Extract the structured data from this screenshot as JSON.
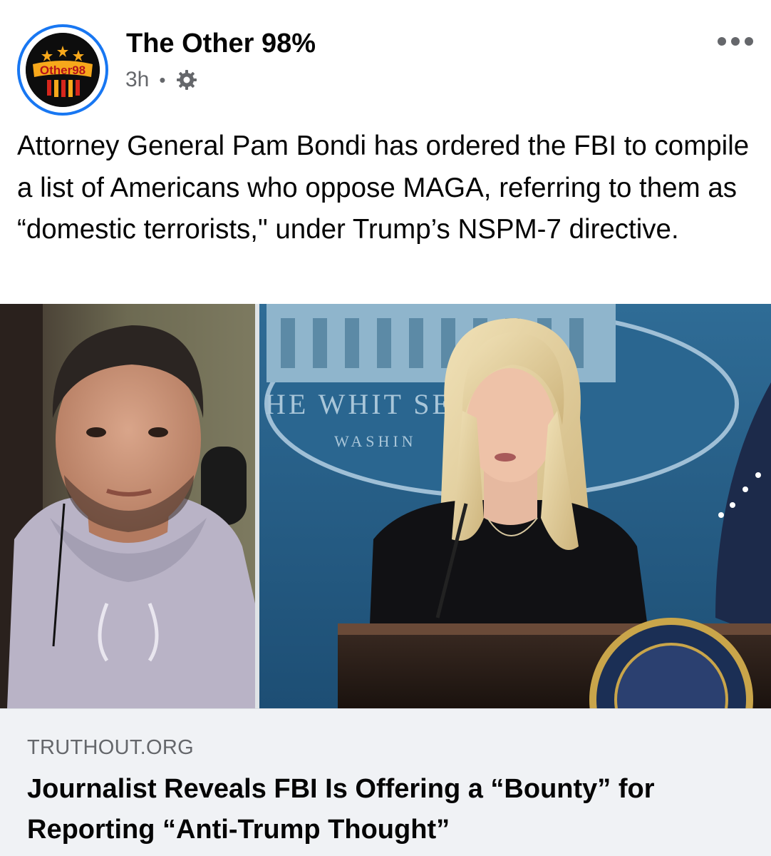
{
  "post": {
    "page_name": "The Other 98%",
    "avatar_text": "Other98",
    "time": "3h",
    "separator": "•",
    "audience_icon": "gear-icon",
    "more_icon": "more-horizontal-icon",
    "caption": "Attorney General Pam Bondi has ordered the FBI to compile a list of Americans who oppose MAGA, referring to them as “domestic terrorists,\" under Trump’s NSPM-7 directive."
  },
  "link": {
    "image_sign_top": "HE WHIT  SE",
    "image_sign_bottom": "WASHIN",
    "domain": "TRUTHOUT.ORG",
    "title": "Journalist Reveals FBI Is Offering a “Bounty” for Reporting “Anti-Trump Thought”"
  },
  "colors": {
    "brand_blue": "#1877f2",
    "secondary_text": "#65676b",
    "footer_bg": "#f0f2f5",
    "avatar_orange": "#f7a81b",
    "avatar_red": "#d6261c"
  }
}
